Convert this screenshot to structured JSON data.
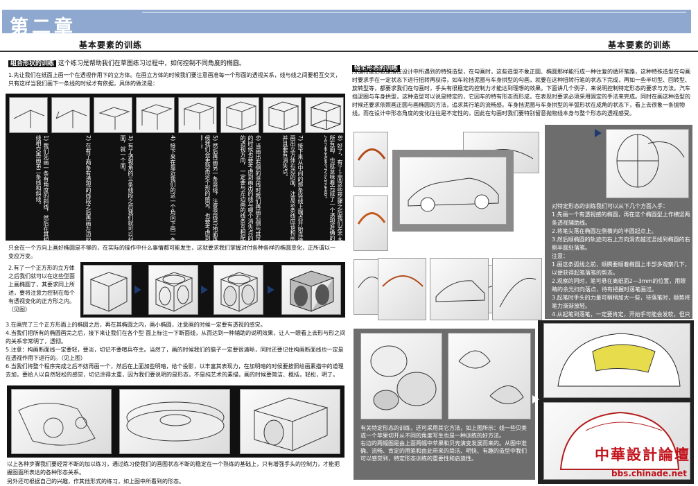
{
  "header": {
    "chapter": "第二章",
    "subtitle_left": "基本要素的训练",
    "subtitle_right": "基本要素的训练"
  },
  "left": {
    "tag": "组合形状的训练",
    "intro": "这个练习是帮助我们在草图练习过程中，如何控制不同角度的椭圆。",
    "p1": "1.先让我们在纸面上画一个在透视作用下的立方体。在画立方体的时候我们要注意画准每一个形面的透视关系，线与线之间要相互交叉，只有这样当我们画下一条线的时候才有依据，具体的做法是：",
    "steps": [
      "1) 我们先画一条有角度的斜线，然后在其相交的地方画另一条线相交再画第二条线和斜线。",
      "2) 在有了两条有透视的线段之后再画左边的另一条透视线。",
      "3) 有了透视角的三条线段之后我们就可以封闭这个立方体的顶面，就一个面。",
      "4) 接下来在靠近我们的这一个角向下画一条竖线。",
      "5) 然后再画另一条竖线，注意竖线与地面垂直，这样画形的时候我们会更熟悉这个形的感觉，也要考虑到这条线的消失点在哪儿。",
      "6) 当画出右侧的竖线时我们再画右侧与其平行的线，注意在画的时候也要考虑到画出的线与哪个消失点的关系，注意这条线的透视方向，一定要与左边画的线条互相配合才能让形体的透视看起来正确。",
      "7) 接下来从中间的那条竖线上端点开始连接到右边的竖线上，画出立方体右边的面，注意这条线应该和前面画好的线平行，并且要有消失点。",
      "8) 好了，有了上面这些步骤之后我们差不多就封闭了立方体的所有面，也就意味着完成了一个透视准确的立方体，最后画出立方体底面的交叉点连接。"
    ],
    "p2": "只会在一个方向上画好椭圆是不够的，在实际的操作中什么事情都可能发生，这就要求我们掌握对付各种各样的椭圆变化，正所谓以一变应万变。",
    "p3": "2.有了一个正方形的立方体之后我们就可以在这些型面上画椭圆了，其要求同上所述，要将注意力控制在每个有透视变化的正方形之内。（见图）",
    "p4": [
      "3.在画完了三个正方形面上的椭圆之后，再在其椭圆之内，画小椭圆，注意画的时候一定要有透视的感觉。",
      "4.当我们把所有的椭圆画完之后，接下来让我们在各个型 面上标注一下断面线，从而达到一种辅助的说明效果，让人一眼看上去形与形之间的关系非常明了，透彻。",
      "5.注意：构画断面线一定要轻，要淡，切记不要喧兵夺主。当然了，画的时候我们的脑子一定要很清晰，同时还要记住构画断面线也一定是在透视作用下进行的。（见上图）",
      "6.当我们将整个程序完成之后不妨再画一个，然后在上面加些明暗，给个投影，以丰富其表现力，在加明暗的时候要按照绘画素描中的道理去加，要给人以自然轻松的感觉，切记涂得太重，因为我们要说明的是形态，不是纯艺术的素描，画的时候要简洁、概括，轻松，明了。"
    ],
    "p5": "以上各种步骤我们要经常不断的加以练习，通过练习使我们的画图状态不断的稳定在一个熟练的基础上，只有增强手头的控制力，才能把握图面所表达的各种形态关系。",
    "p6": "另外还可根据自己的兴趣，作其他形式的练习，如上图中所看到的形态。"
  },
  "right": {
    "tag": "特定形态的训练",
    "p1": "所谓特定形态是指在设计中所遇到的特殊造型，在勾画时，这些造型不象正圆、椭圆那样能行成一种往复的循环笔路，这种特殊造型在勾画时要求手在一定状态下进行扭转再获得，如车轮挡泥圈与车身拱型的勾画，就要在这种扭转行笔的状态下完成，再如一些半切型、回转型、旋转型等，都要求我们在勾画时，手头有很稳定的控制力才能达到理想的效果。下面讲几个例子，来说明控制特定形态的要求与方法。汽车挡泥圈与车身拱型，这种造型可以说是特定的，它因车的特有形态而形成，在表现时要求必须采用固定的手法来完成。同时在画这种造型的时候还要求依照画正圆与画椭圆的方法，追求其行笔的流畅感。车身挡泥圈与车身拱型的半弧形状在成角的状态下，看上去很象一条抛物线。而在设计中形态角度的变化往往是不定性的，因此在勾画时我们要特别留意抛物线本身与整个形态的透视感受。",
    "methods": [
      "对特定形态的训练我们可以从下几个方面入手：",
      "1.先画一个有透视感的椭圆，再在这个椭圆型上作横竖两条透视辅助线。",
      "2.将笔尖落在椭圆左侧横向的半圆起点上。",
      "3.然后顺椭圆的轨迹向右上方向滑去越过竖线到椭圆的右侧半圆处落笔。",
      "注意：",
      "1.画这条弧线之前，顺腾要顺着椭圆上半部多观察几下，以便获得起笔落笔的势态。",
      "2.观察的同时，笔可悬在离纸面2—3mm的位置，用眼睛的余光扫向落点，待有把握时落笔画过。",
      "3.起笔时手头的力量可稍稍加大一些，待落笔时，顺势将笔力渐渐放轻。",
      "4.从起笔到落笔，一定要肯定，开始手可能会发软，但只要多练便可漫漫稳定下来。"
    ],
    "bottom": [
      "有关特定形态的训练，还可采用其它方法，如上图所示：线一些贝类或一个苹果切开从不同的角度写生也是一种训练的好方法。",
      "右边的两幅图是由上面两幅中苹果和贝壳演变发展而来的。从图中准确、流畅、肯定的用笔和由此带来的简洁、明快、有趣的造型中我们可以感觉到，特定形态训练的重要性和启迪性。"
    ]
  },
  "watermark": {
    "logo": "中華設計論壇",
    "url": "bbs.chinade.net"
  },
  "colors": {
    "header_bar": "#8fa8cf",
    "arrow": "#1e3b70",
    "logo": "#c2121b"
  }
}
